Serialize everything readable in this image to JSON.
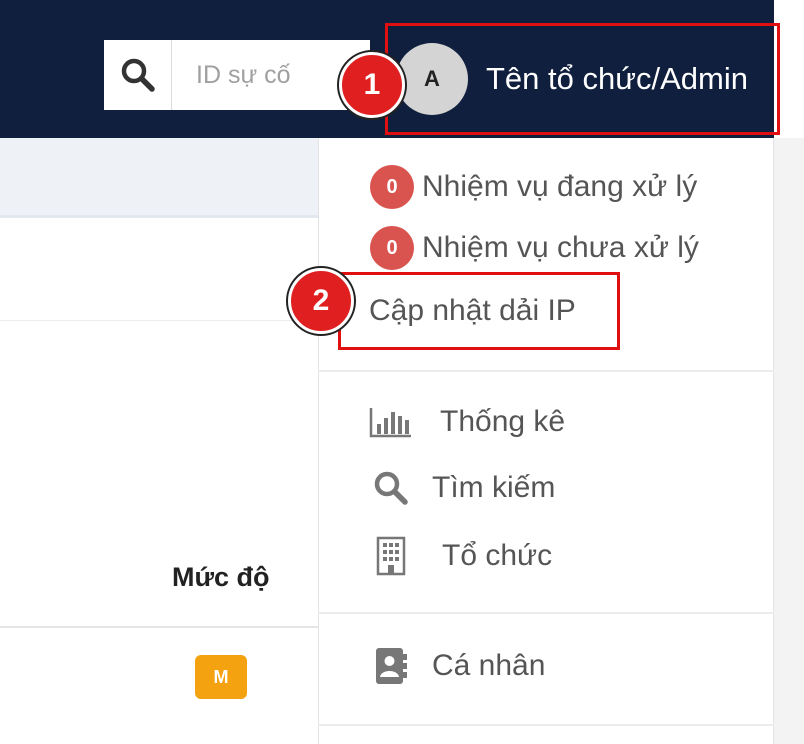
{
  "header": {
    "search": {
      "placeholder": "ID sự cố",
      "icon": "search-icon"
    },
    "user": {
      "avatar_initial": "A",
      "name": "Tên tổ chức/Admin"
    }
  },
  "annotations": {
    "marker_1": "1",
    "marker_2": "2",
    "color": "#e01010"
  },
  "dropdown": {
    "tasks": [
      {
        "count": "0",
        "label": "Nhiệm vụ đang xử lý"
      },
      {
        "count": "0",
        "label": "Nhiệm vụ chưa xử lý"
      }
    ],
    "update_ip": "Cập nhật dải IP",
    "nav": [
      {
        "icon": "bar-chart-icon",
        "label": "Thống kê"
      },
      {
        "icon": "search-icon",
        "label": "Tìm kiếm"
      },
      {
        "icon": "building-icon",
        "label": "Tổ chức"
      }
    ],
    "personal": {
      "icon": "contact-book-icon",
      "label": "Cá nhân"
    }
  },
  "table": {
    "severity_header": "Mức độ",
    "severity_badge": "M",
    "severity_color": "#f4a20f"
  },
  "colors": {
    "topbar": "#0f1f3d",
    "badge": "#d9534f"
  }
}
